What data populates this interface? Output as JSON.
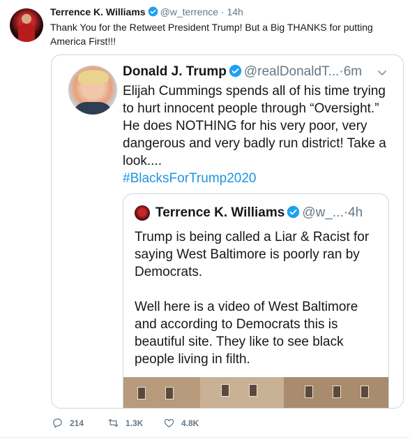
{
  "tweet": {
    "author_name": "Terrence K. Williams",
    "handle": "@w_terrence",
    "separator": "·",
    "time": "14h",
    "text": "Thank You for the Retweet President Trump! But a Big THANKS for putting America First!!!"
  },
  "quoted": {
    "author_name": "Donald J. Trump",
    "handle": "@realDonaldT...",
    "separator": "·",
    "time": "6m",
    "text": "Elijah Cummings spends all of his time trying to hurt innocent people through “Oversight.” He does NOTHING for his very poor, very dangerous and very badly run district! Take a look....",
    "hashtag": "#BlacksForTrump2020"
  },
  "nested": {
    "author_name": "Terrence K. Williams",
    "handle": "@w_...",
    "separator": "·",
    "time": "4h",
    "paragraph1": "Trump is being called a Liar & Racist for saying West Baltimore is poorly ran by Democrats.",
    "paragraph2": "Well here is a video of West Baltimore and according to Democrats this is beautiful site. They like to see black people living in filth."
  },
  "actions": {
    "replies": "214",
    "retweets": "1.3K",
    "likes": "4.8K"
  },
  "colors": {
    "verified": "#1da1f2",
    "link": "#1b95e0",
    "muted": "#657786",
    "border": "#ccd6dd"
  }
}
